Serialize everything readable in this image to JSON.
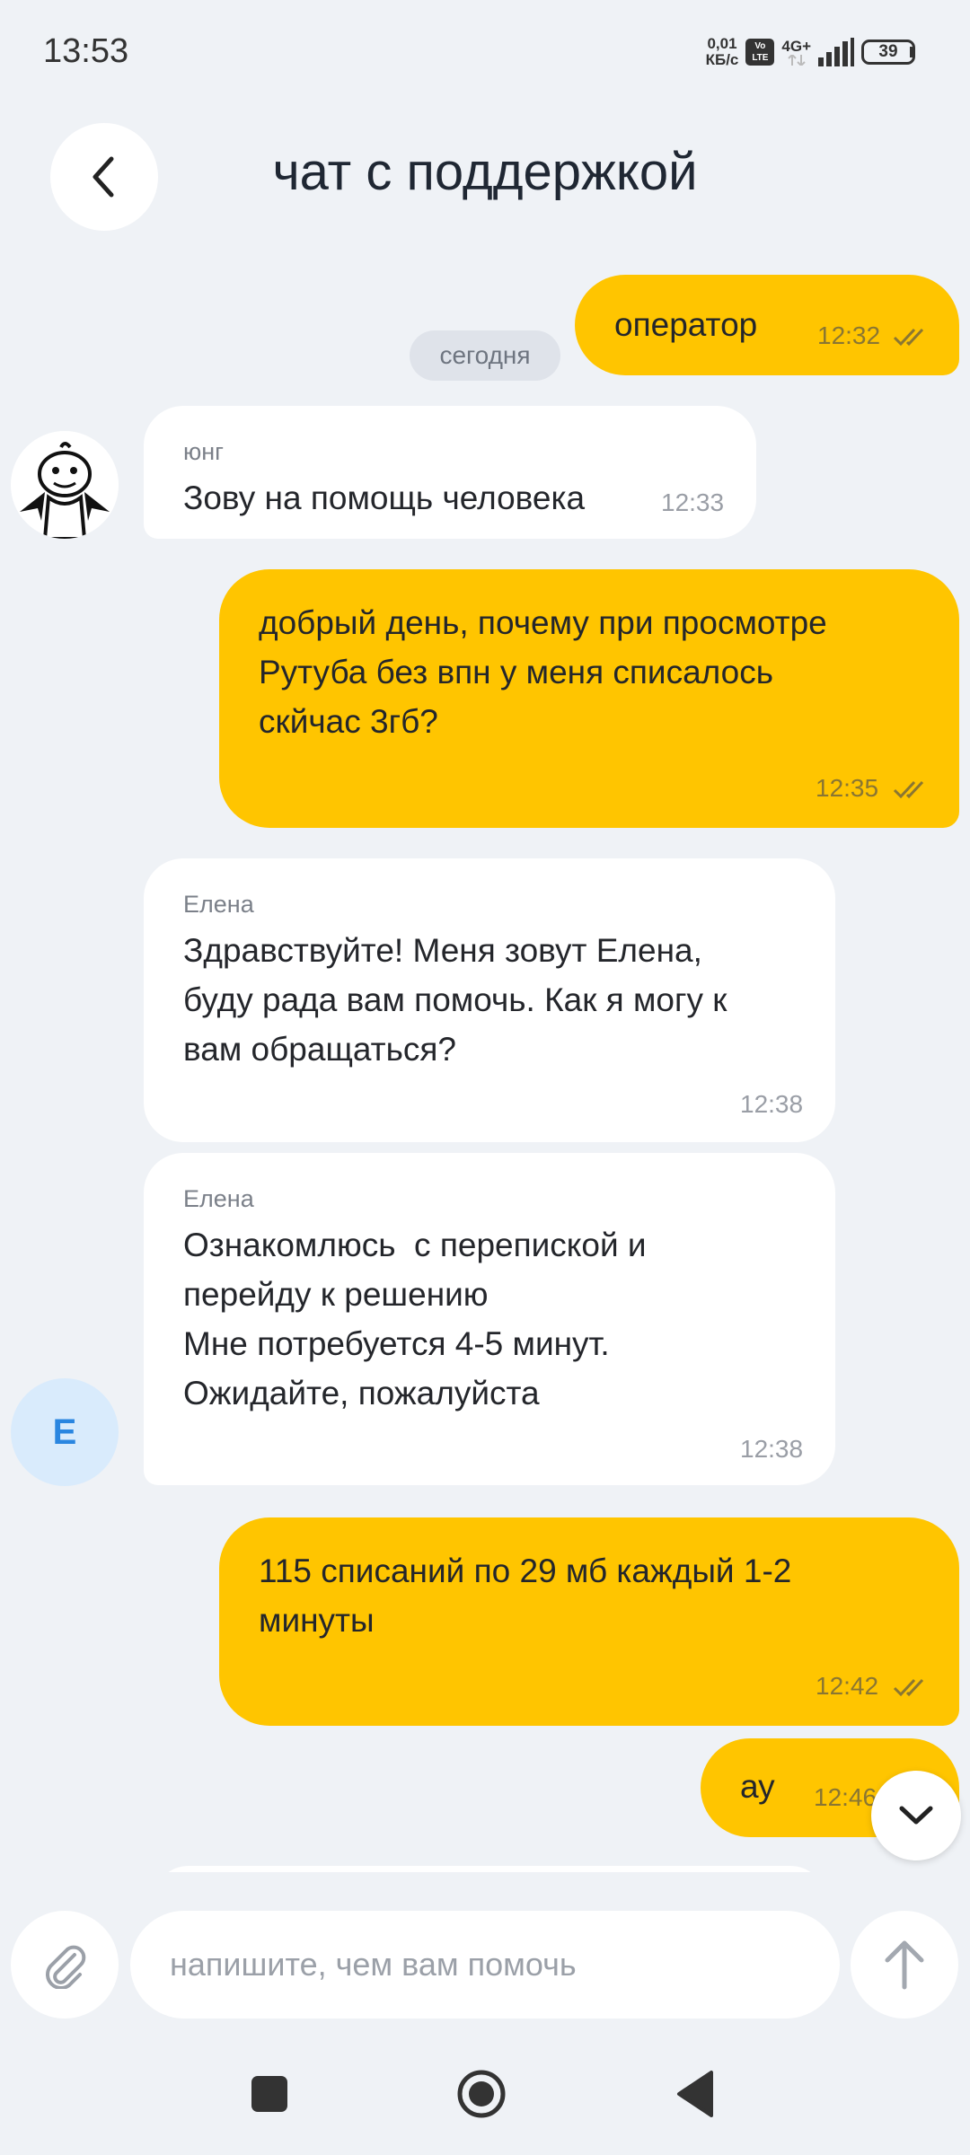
{
  "status_bar": {
    "time": "13:53",
    "net_speed_value": "0,01",
    "net_speed_unit": "КБ/с",
    "volte_top": "Vo",
    "volte_bottom": "LTE",
    "network": "4G+",
    "battery": "39"
  },
  "header": {
    "title": "чат с поддержкой"
  },
  "date_chip": "сегодня",
  "messages": [
    {
      "direction": "out",
      "text": "оператор",
      "time": "12:32",
      "read": true
    },
    {
      "direction": "in",
      "sender": "юнг",
      "text": "Зову на помощь человека",
      "time": "12:33",
      "avatar": "bot-avatar"
    },
    {
      "direction": "out",
      "text": "добрый день, почему при просмотре\nРутуба без впн у меня списалось\nскйчас 3гб?",
      "time": "12:35",
      "read": true
    },
    {
      "direction": "in",
      "sender": "Елена",
      "text": "Здравствуйте! Меня зовут Елена,\nбуду рада вам помочь. Как я могу к\nвам обращаться?",
      "time": "12:38"
    },
    {
      "direction": "in",
      "sender": "Елена",
      "text": "Ознакомлюсь  с перепиской и\nперейду к решению\nМне потребуется 4-5 минут.\nОжидайте, пожалуйста",
      "time": "12:38",
      "avatar_letter": "Е"
    },
    {
      "direction": "out",
      "text": "115 списаний по 29 мб каждый 1-2\nминуты",
      "time": "12:42",
      "read": true
    },
    {
      "direction": "out",
      "text": "ау",
      "time": "12:46",
      "read": true
    }
  ],
  "composer": {
    "placeholder": "напишите, чем вам помочь",
    "value": ""
  },
  "icons": {
    "back": "chevron-left-icon",
    "attach": "paperclip-icon",
    "send": "arrow-up-icon",
    "scroll_down": "chevron-down-icon"
  },
  "colors": {
    "background": "#eff2f6",
    "outgoing_bubble": "#ffc500",
    "incoming_bubble": "#ffffff",
    "avatar_e_bg": "#d9ebfc",
    "avatar_e_fg": "#2a86e0"
  }
}
